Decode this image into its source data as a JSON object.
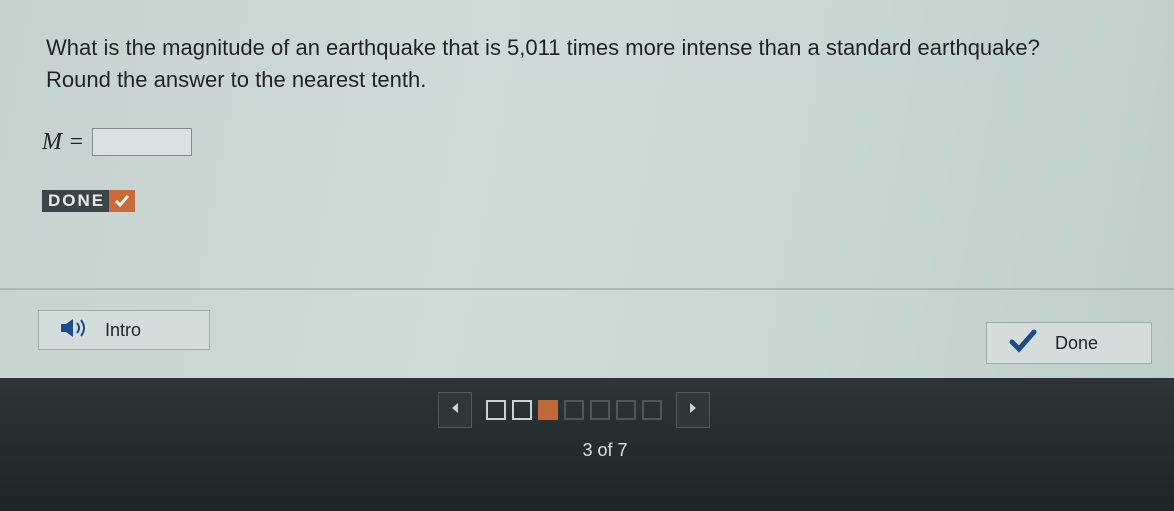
{
  "question": {
    "line1": "What is the magnitude of an earthquake that is 5,011 times more intense than a standard earthquake?",
    "line2": "Round the answer to the nearest tenth."
  },
  "answer": {
    "variable_label": "M =",
    "value": ""
  },
  "done_badge": {
    "label": "DONE",
    "icon": "checkmark-icon"
  },
  "buttons": {
    "intro": {
      "label": "Intro",
      "icon": "speaker-icon"
    },
    "done": {
      "label": "Done",
      "icon": "checkmark-icon"
    }
  },
  "pager": {
    "page_text": "3 of 7",
    "current": 3,
    "total": 7,
    "step_states": [
      "done",
      "done",
      "current",
      "todo",
      "todo",
      "todo",
      "todo"
    ]
  },
  "colors": {
    "accent": "#c06a3a",
    "check": "#1f4a8a",
    "footer_bg": "#262e30"
  }
}
